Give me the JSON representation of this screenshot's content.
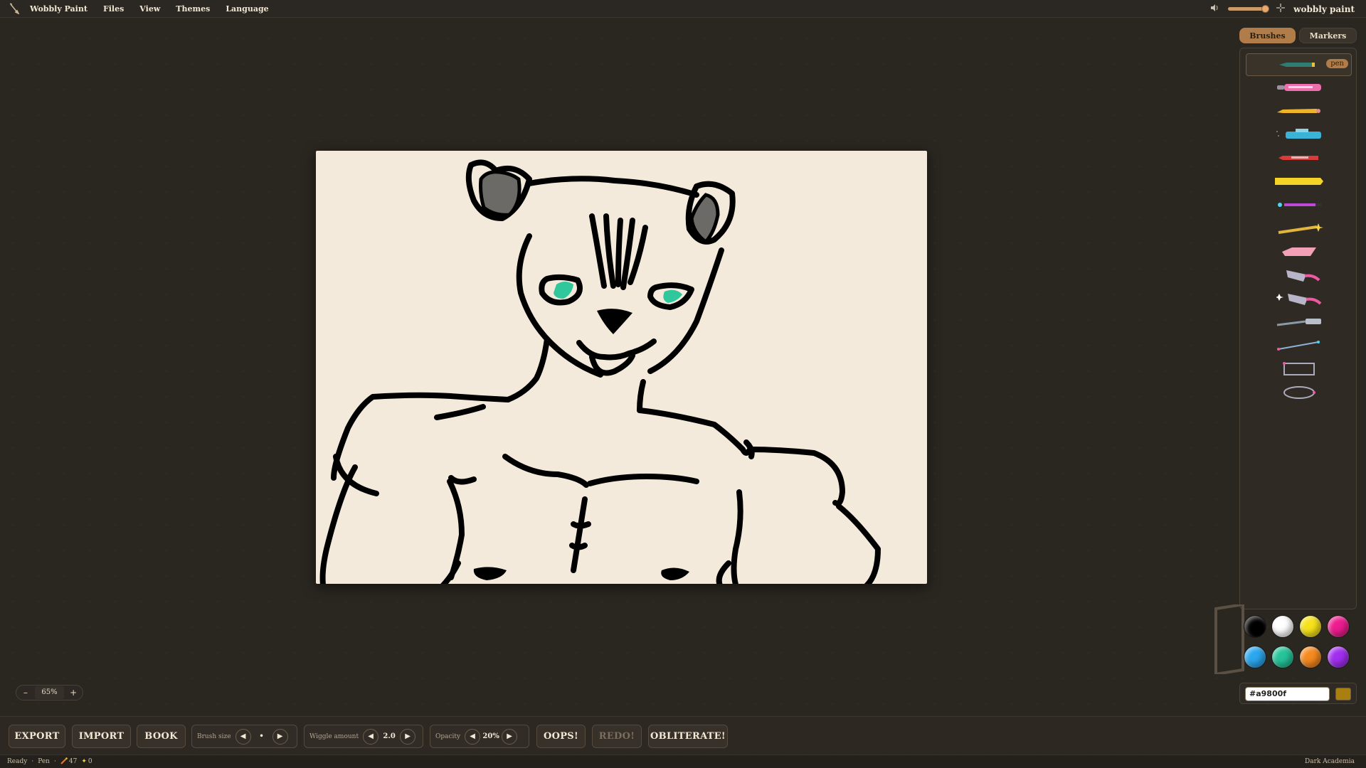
{
  "menubar": {
    "app_title": "Wobbly Paint",
    "items": [
      "Files",
      "View",
      "Themes",
      "Language"
    ],
    "brand": "wobbly paint"
  },
  "panel": {
    "tabs": [
      "Brushes",
      "Markers"
    ],
    "selected_tool_badge": "pen",
    "tools": [
      "pen",
      "pink-marker",
      "pencil",
      "spray-marker",
      "red-marker",
      "highlighter",
      "glow-pen",
      "sparkle-wand",
      "eraser",
      "smudge-eraser",
      "sparkle-eraser",
      "brush",
      "line",
      "rectangle",
      "ellipse"
    ]
  },
  "palette": {
    "swatches": [
      "#000000",
      "#ffffff",
      "#f6e21a",
      "#ee1c8e",
      "#2ba7ef",
      "#26c49a",
      "#f68a1f",
      "#a22ef0"
    ],
    "hex_value": "#a9800f",
    "current_color": "#a9800f"
  },
  "zoom": {
    "minus": "–",
    "value": "65%",
    "plus": "+"
  },
  "toolbar": {
    "export": "EXPORT",
    "import": "IMPORT",
    "book": "BOOK",
    "brush_size_label": "Brush size",
    "brush_size_value": "•",
    "wiggle_label": "Wiggle amount",
    "wiggle_value": "2.0",
    "opacity_label": "Opacity",
    "opacity_value": "20%",
    "oops": "OOPS!",
    "redo": "REDO!",
    "obliterate": "OBLITERATE!"
  },
  "statusbar": {
    "state": "Ready",
    "sep1": "·",
    "tool": "Pen",
    "sep2": "·",
    "strokes": "47",
    "sparkles": "0",
    "theme": "Dark Academia"
  }
}
